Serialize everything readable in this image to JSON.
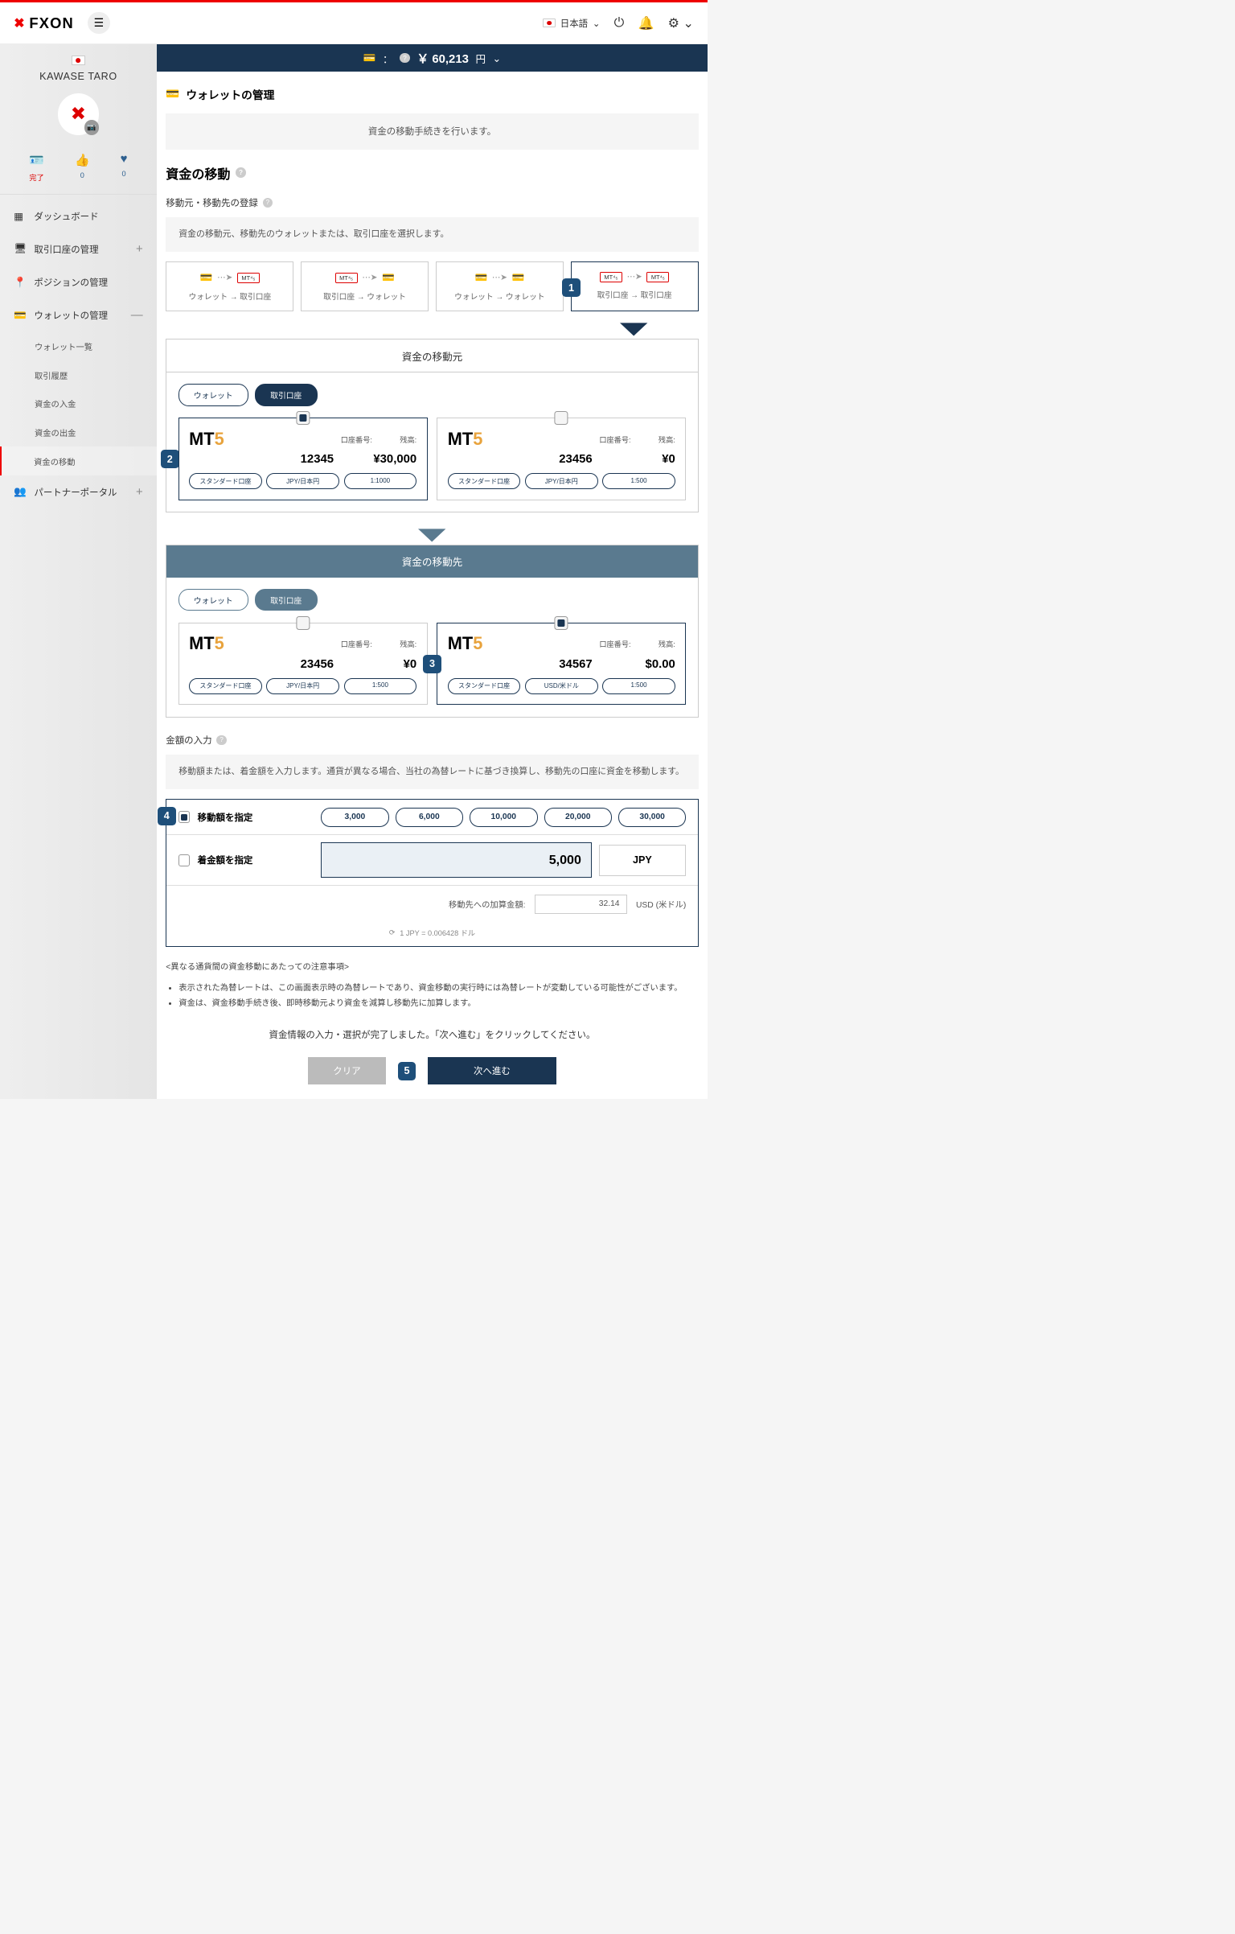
{
  "header": {
    "lang": "日本語"
  },
  "profile": {
    "name": "KAWASE TARO"
  },
  "stats": {
    "s1": "完了",
    "s2": "0",
    "s3": "0"
  },
  "nav": {
    "dashboard": "ダッシュボード",
    "accounts": "取引口座の管理",
    "positions": "ポジションの管理",
    "wallet": "ウォレットの管理",
    "partner": "パートナーポータル"
  },
  "subnav": {
    "list": "ウォレット一覧",
    "history": "取引履歴",
    "deposit": "資金の入金",
    "withdraw": "資金の出金",
    "transfer": "資金の移動"
  },
  "balance": {
    "label": "：",
    "amount": "￥ 60,213",
    "currency": "円"
  },
  "page": {
    "title": "ウォレットの管理",
    "info": "資金の移動手続きを行います。",
    "section_title": "資金の移動",
    "reg_label": "移動元・移動先の登録",
    "reg_desc": "資金の移動元、移動先のウォレットまたは、取引口座を選択します。"
  },
  "dirs": {
    "d1": "ウォレット → 取引口座",
    "d2": "取引口座 → ウォレット",
    "d3": "ウォレット → ウォレット",
    "d4": "取引口座 → 取引口座"
  },
  "src": {
    "header": "資金の移動元",
    "wallet": "ウォレット",
    "account": "取引口座"
  },
  "dest": {
    "header": "資金の移動先"
  },
  "acc_labels": {
    "num": "口座番号:",
    "bal": "残高:"
  },
  "accounts_src": [
    {
      "num": "12345",
      "bal": "¥30,000",
      "t1": "スタンダード口座",
      "t2": "JPY/日本円",
      "t3": "1:1000"
    },
    {
      "num": "23456",
      "bal": "¥0",
      "t1": "スタンダード口座",
      "t2": "JPY/日本円",
      "t3": "1:500"
    }
  ],
  "accounts_dest": [
    {
      "num": "23456",
      "bal": "¥0",
      "t1": "スタンダード口座",
      "t2": "JPY/日本円",
      "t3": "1:500"
    },
    {
      "num": "34567",
      "bal": "$0.00",
      "t1": "スタンダード口座",
      "t2": "USD/米ドル",
      "t3": "1:500"
    }
  ],
  "amount": {
    "label": "金額の入力",
    "desc": "移動額または、着金額を入力します。通貨が異なる場合、当社の為替レートに基づき換算し、移動先の口座に資金を移動します。",
    "spec_transfer": "移動額を指定",
    "spec_receive": "着金額を指定",
    "presets": [
      "3,000",
      "6,000",
      "10,000",
      "20,000",
      "30,000"
    ],
    "value": "5,000",
    "currency": "JPY",
    "conv_label": "移動先への加算金額:",
    "conv_value": "32.14",
    "conv_currency": "USD (米ドル)",
    "rate": "1 JPY = 0.006428 ドル"
  },
  "notes": {
    "title": "<異なる通貨間の資金移動にあたっての注意事項>",
    "n1": "表示された為替レートは、この画面表示時の為替レートであり、資金移動の実行時には為替レートが変動している可能性がございます。",
    "n2": "資金は、資金移動手続き後、即時移動元より資金を減算し移動先に加算します。"
  },
  "complete": "資金情報の入力・選択が完了しました。「次へ進む」をクリックしてください。",
  "actions": {
    "clear": "クリア",
    "next": "次へ進む"
  }
}
